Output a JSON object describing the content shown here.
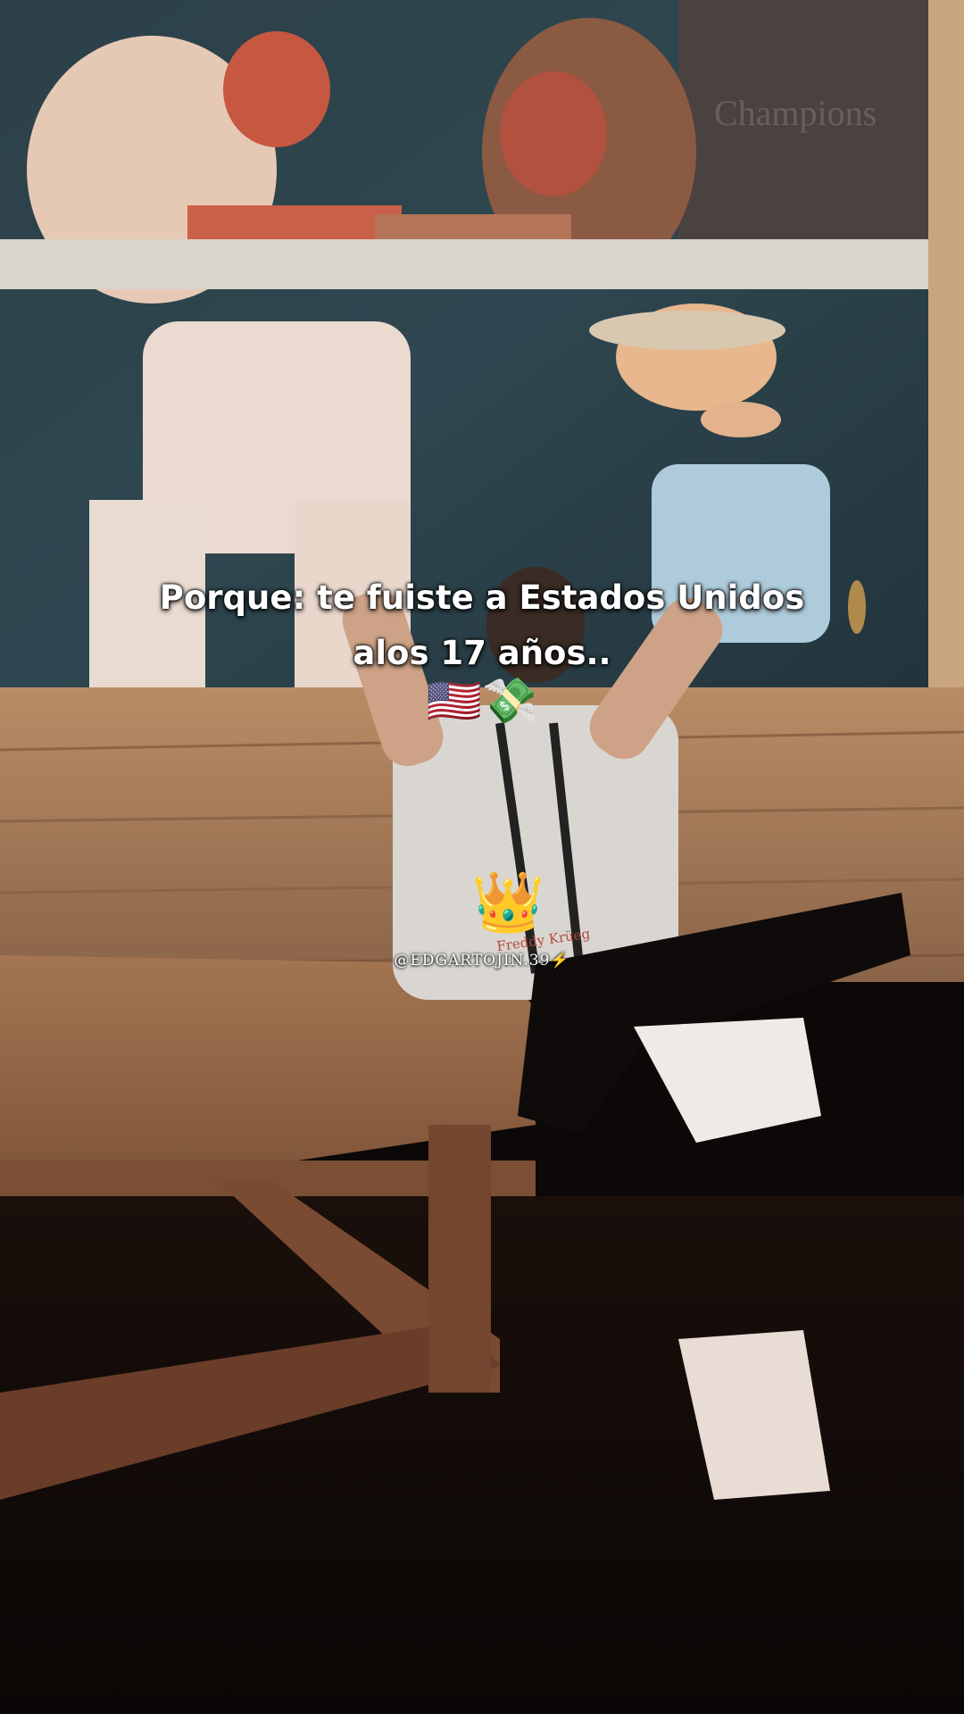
{
  "caption": {
    "line1": "Porque: te fuiste a Estados Unidos",
    "line2": "alos 17 años.."
  },
  "emojis": "🇺🇸💸",
  "crown": "👑",
  "handle": "@EDGARTOJIN.39⚡",
  "mural_sign": "Champions",
  "shirt_text": "Freddy Krüeg"
}
